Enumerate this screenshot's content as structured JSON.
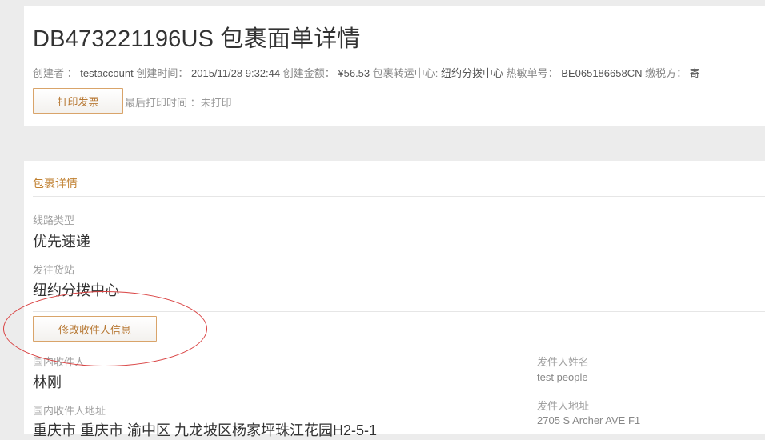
{
  "header": {
    "title": "DB473221196US 包裹面单详情",
    "meta": {
      "creator_label": "创建者 ：",
      "creator": "testaccount",
      "created_time_label": "创建时间：",
      "created_time": "2015/11/28 9:32:44",
      "amount_label": "创建金额：",
      "amount": "¥56.53",
      "center_label": "包裹转运中心:",
      "center": "纽约分拨中心",
      "hot_tracking_label": "热敏单号：",
      "hot_tracking": "BE065186658CN",
      "tax_payer_label": "缴税方：",
      "tax_payer": "寄"
    },
    "print_button": "打印发票",
    "last_print_label": "最后打印时间 ：",
    "last_print_value": "未打印"
  },
  "package": {
    "section_title": "包裹详情",
    "route_label": "线路类型",
    "route_value": "优先速递",
    "origin_label": "发往货站",
    "origin_value": "纽约分拨中心",
    "edit_button": "修改收件人信息",
    "recipient_label": "国内收件人",
    "recipient_value": "林刚",
    "recipient_addr_label": "国内收件人地址",
    "recipient_addr_value": "重庆市 重庆市 渝中区 九龙坡区杨家坪珠江花园H2-5-1",
    "sender_name_label": "发件人姓名",
    "sender_name_value": "test people",
    "sender_addr_label": "发件人地址",
    "sender_addr_value": "2705 S Archer AVE F1"
  },
  "colors": {
    "accent": "#c08030",
    "button_border": "#d9a46a",
    "annotation_circle": "#d94242",
    "background": "#ececec"
  }
}
